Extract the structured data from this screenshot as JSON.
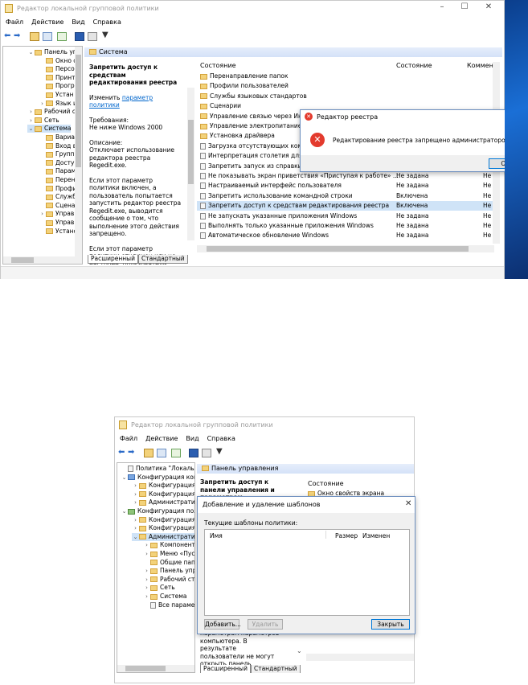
{
  "top": {
    "title": "Редактор локальной групповой политики",
    "menu": [
      "Файл",
      "Действие",
      "Вид",
      "Справка"
    ],
    "tree": [
      {
        "label": "Панель уп",
        "indent": 30,
        "arrow": "expanded"
      },
      {
        "label": "Окно с",
        "indent": 44,
        "arrow": ""
      },
      {
        "label": "Персо",
        "indent": 44,
        "arrow": ""
      },
      {
        "label": "Принт",
        "indent": 44,
        "arrow": ""
      },
      {
        "label": "Прогр",
        "indent": 44,
        "arrow": ""
      },
      {
        "label": "Устан",
        "indent": 44,
        "arrow": ""
      },
      {
        "label": "Язык и",
        "indent": 44,
        "arrow": "collapsed"
      },
      {
        "label": "Рабочий с",
        "indent": 30,
        "arrow": "collapsed"
      },
      {
        "label": "Сеть",
        "indent": 30,
        "arrow": "collapsed"
      },
      {
        "label": "Система",
        "indent": 30,
        "arrow": "expanded",
        "selected": true
      },
      {
        "label": "Вариа",
        "indent": 44,
        "arrow": ""
      },
      {
        "label": "Вход в",
        "indent": 44,
        "arrow": ""
      },
      {
        "label": "Групп",
        "indent": 44,
        "arrow": ""
      },
      {
        "label": "Досту",
        "indent": 44,
        "arrow": ""
      },
      {
        "label": "Парам",
        "indent": 44,
        "arrow": ""
      },
      {
        "label": "Перен",
        "indent": 44,
        "arrow": ""
      },
      {
        "label": "Профи",
        "indent": 44,
        "arrow": ""
      },
      {
        "label": "Служб",
        "indent": 44,
        "arrow": ""
      },
      {
        "label": "Сцена",
        "indent": 44,
        "arrow": ""
      },
      {
        "label": "Управ.",
        "indent": 44,
        "arrow": "collapsed"
      },
      {
        "label": "Управ.",
        "indent": 44,
        "arrow": ""
      },
      {
        "label": "Устанс",
        "indent": 44,
        "arrow": ""
      }
    ],
    "section_title": "Система",
    "desc": {
      "heading": "Запретить доступ к средствам редактирования реестра",
      "edit_prefix": "Изменить ",
      "edit_link": "параметр политики",
      "req_label": "Требования:",
      "req_value": "Не ниже Windows 2000",
      "desc_label": "Описание:",
      "desc_text": "Отключает использование редактора реестра Regedit.exe.",
      "para2": "Если этот параметр политики включен, а пользователь попытается запустить редактор реестра Regedit.exe, выводится сообщение о том, что выполнение этого действия запрещено.",
      "para3": "Если этот параметр политики отключен или не настроен, пользователи могут запускать редактор реестра Regedit.exe в"
    },
    "columns": {
      "name": "Состояние",
      "state": "Состояние",
      "comment": "Коммен"
    },
    "rows": [
      {
        "name": "Перенаправление папок",
        "state": "",
        "comment": "",
        "type": "folder"
      },
      {
        "name": "Профили пользователей",
        "state": "",
        "comment": "",
        "type": "folder"
      },
      {
        "name": "Службы языковых стандартов",
        "state": "",
        "comment": "",
        "type": "folder"
      },
      {
        "name": "Сценарии",
        "state": "",
        "comment": "",
        "type": "folder"
      },
      {
        "name": "Управление связью через Интер",
        "state": "",
        "comment": "",
        "type": "folder"
      },
      {
        "name": "Управление электропитанием",
        "state": "",
        "comment": "",
        "type": "folder"
      },
      {
        "name": "Установка драйвера",
        "state": "",
        "comment": "",
        "type": "folder"
      },
      {
        "name": "Загрузка отсутствующих компо",
        "state": "",
        "comment": "",
        "type": "policy"
      },
      {
        "name": "Интерпретация столетия для 20",
        "state": "",
        "comment": "",
        "type": "policy"
      },
      {
        "name": "Запретить запуск из справки пе",
        "state": "",
        "comment": "",
        "type": "policy"
      },
      {
        "name": "Не показывать экран приветствия «Приступая к работе» ...",
        "state": "Не задана",
        "comment": "Не",
        "type": "policy"
      },
      {
        "name": "Настраиваемый интерфейс пользователя",
        "state": "Не задана",
        "comment": "Не",
        "type": "policy"
      },
      {
        "name": "Запретить использование командной строки",
        "state": "Включена",
        "comment": "Не",
        "type": "policy"
      },
      {
        "name": "Запретить доступ к средствам редактирования реестра",
        "state": "Включена",
        "comment": "Не",
        "type": "policy",
        "selected": true
      },
      {
        "name": "Не запускать указанные приложения Windows",
        "state": "Не задана",
        "comment": "Не",
        "type": "policy"
      },
      {
        "name": "Выполнять только указанные приложения Windows",
        "state": "Не задана",
        "comment": "Не",
        "type": "policy"
      },
      {
        "name": "Автоматическое обновление Windows",
        "state": "Не задана",
        "comment": "Не",
        "type": "policy"
      }
    ],
    "tabs": [
      "Расширенный",
      "Стандартный"
    ],
    "dialog": {
      "title": "Редактор реестра",
      "message": "Редактирование реестра запрещено администратором системы.",
      "ok": "ОК"
    }
  },
  "bottom": {
    "title": "Редактор локальной групповой политики",
    "menu": [
      "Файл",
      "Действие",
      "Вид",
      "Справка"
    ],
    "tree": [
      {
        "label": "Политика \"Локальный",
        "indent": 4,
        "arrow": "",
        "icon": "policy"
      },
      {
        "label": "Конфигурация комп",
        "indent": 4,
        "arrow": "expanded",
        "icon": "computer"
      },
      {
        "label": "Конфигурация п",
        "indent": 18,
        "arrow": "collapsed"
      },
      {
        "label": "Конфигурация V",
        "indent": 18,
        "arrow": "collapsed"
      },
      {
        "label": "Административ",
        "indent": 18,
        "arrow": "collapsed"
      },
      {
        "label": "Конфигурация поль",
        "indent": 4,
        "arrow": "expanded",
        "icon": "user"
      },
      {
        "label": "Конфигурация п",
        "indent": 18,
        "arrow": "collapsed"
      },
      {
        "label": "Конфигурация V",
        "indent": 18,
        "arrow": "collapsed"
      },
      {
        "label": "Административн",
        "indent": 18,
        "arrow": "expanded",
        "selected": true
      },
      {
        "label": "Компоненты",
        "indent": 32,
        "arrow": "collapsed"
      },
      {
        "label": "Меню «Пуск",
        "indent": 32,
        "arrow": "collapsed"
      },
      {
        "label": "Общие папк",
        "indent": 32,
        "arrow": ""
      },
      {
        "label": "Панель упра",
        "indent": 32,
        "arrow": "collapsed"
      },
      {
        "label": "Рабочий сто.",
        "indent": 32,
        "arrow": "collapsed"
      },
      {
        "label": "Сеть",
        "indent": 32,
        "arrow": "collapsed"
      },
      {
        "label": "Система",
        "indent": 32,
        "arrow": "collapsed"
      },
      {
        "label": "Все параметр",
        "indent": 32,
        "arrow": "",
        "icon": "policy"
      }
    ],
    "section_title": "Панель управления",
    "desc_heading": "Запретить доступ к панели управления и параметрам",
    "desc_tail": "параметрам параметров компьютера. В результате пользователи не могут открыть панель управления или",
    "col_state": "Состояние",
    "row1": "Окно свойств экрана",
    "tabs": [
      "Расширенный",
      "Стандартный"
    ],
    "dialog": {
      "title": "Добавление и удаление шаблонов",
      "current_label": "Текущие шаблоны политики:",
      "col_name": "Имя",
      "col_size": "Размер",
      "col_changed": "Изменен",
      "add": "Добавить...",
      "remove": "Удалить",
      "close": "Закрыть"
    }
  }
}
